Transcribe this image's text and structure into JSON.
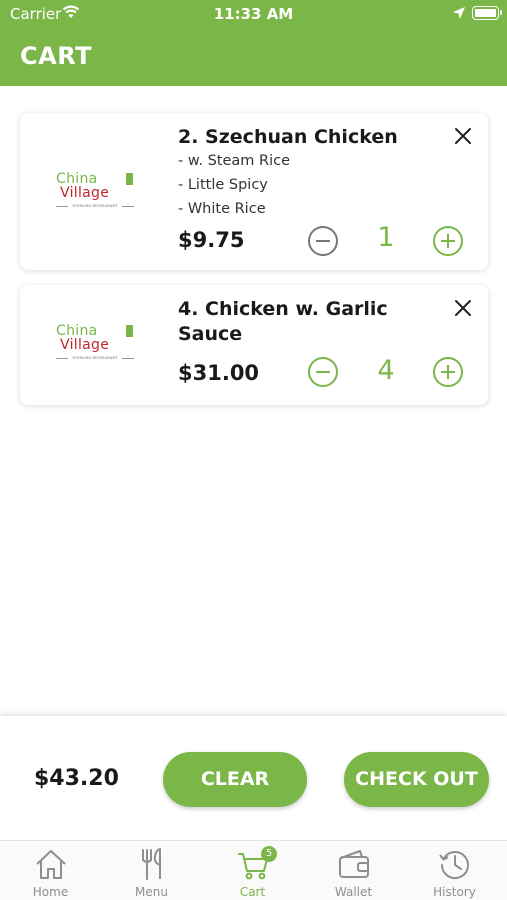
{
  "status_bar": {
    "carrier": "Carrier",
    "time": "11:33 AM"
  },
  "header": {
    "title": "CART"
  },
  "cart": {
    "items": [
      {
        "name": "2. Szechuan Chicken",
        "options": [
          "- w. Steam Rice",
          "- Little Spicy",
          "- White Rice"
        ],
        "price": "$9.75",
        "quantity": "1",
        "logo": {
          "line1": "China",
          "line2": "Village",
          "tagline": "STERLING RESTAURANT"
        }
      },
      {
        "name": "4. Chicken w. Garlic Sauce",
        "options": [],
        "price": "$31.00",
        "quantity": "4",
        "logo": {
          "line1": "China",
          "line2": "Village",
          "tagline": "STERLING RESTAURANT"
        }
      }
    ]
  },
  "footer": {
    "total": "$43.20",
    "clear_label": "CLEAR",
    "checkout_label": "CHECK OUT"
  },
  "tabs": [
    {
      "label": "Home",
      "icon": "home-icon",
      "active": false
    },
    {
      "label": "Menu",
      "icon": "fork-knife-icon",
      "active": false
    },
    {
      "label": "Cart",
      "icon": "cart-icon",
      "active": true,
      "badge": "5"
    },
    {
      "label": "Wallet",
      "icon": "wallet-icon",
      "active": false
    },
    {
      "label": "History",
      "icon": "history-icon",
      "active": false
    }
  ],
  "colors": {
    "brand_green": "#7ab648",
    "logo_red": "#c0272d",
    "tab_inactive": "#8e8e8e"
  }
}
